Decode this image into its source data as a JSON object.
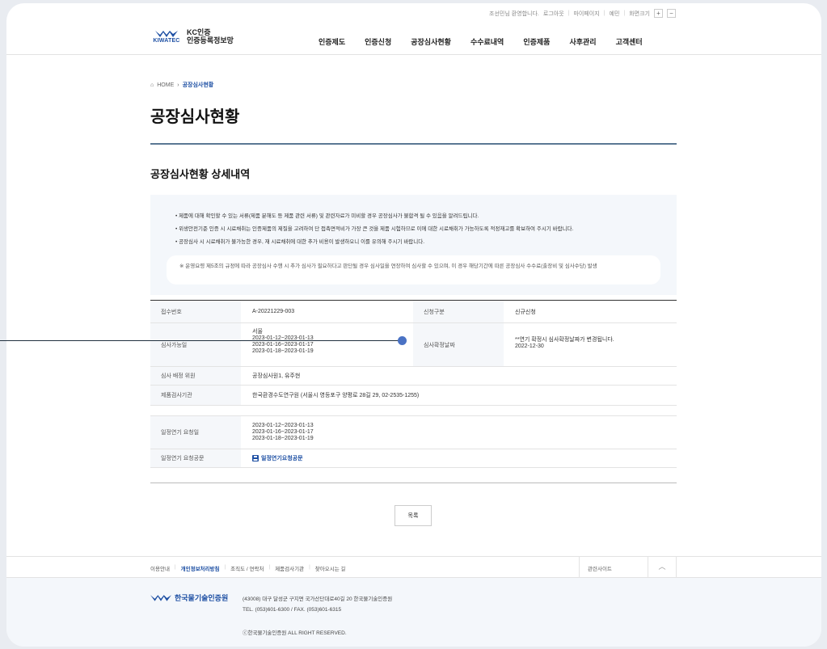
{
  "util": {
    "welcome": "조선민님 환영합니다.",
    "logout": "로그아웃",
    "mypage": "마이페이지",
    "english": "예민",
    "font_size": "화면크기",
    "plus": "+",
    "minus": "−"
  },
  "logo": {
    "brand": "KIWATEC",
    "line1": "KC인증",
    "line2": "인증등록정보망"
  },
  "gnb": [
    "인증제도",
    "인증신청",
    "공장심사현황",
    "수수료내역",
    "인증제품",
    "사후관리",
    "고객센터"
  ],
  "breadcrumb": {
    "home": "HOME",
    "current": "공장심사현황"
  },
  "page_title": "공장심사현황",
  "sub_title": "공장심사현황 상세내역",
  "notice": {
    "items": [
      "• 제품에 대해 확인할 수 있는 서류(제품 분해도 등 제품 관련 서류) 및 관련자료가 미비할 경우 공장심사가 불합격 될 수 있음을 알려드립니다.",
      "• 위생안전기준 인증 시 시료채취는 인증제품의 제질을 고려하여 단 접촉면적비가 가장 큰 것을 제품 시험하므로 이에 대한 시료채취가 가능하도록 적정재고를 확보하여 주시기 바랍니다.",
      "• 공장심사 시 시료채취가 불가능한 경우, 재 시료채취에 대한 추가 비용이 발생하오니 이를 유의해 주시기 바랍니다."
    ],
    "box": "※ 운영요령 제5조의 규정에 따라 공장심사 수행 시 추가 심사가 필요하다고 판단될 경우 심사일을 연장하여 심사할 수 있으며, 이 경우 해당기간에 따른 공장심사 수수료(출장비 및 심사수당) 발생"
  },
  "detail": {
    "receipt_label": "접수번호",
    "receipt_value": "A-20221229-003",
    "apply_type_label": "신청구분",
    "apply_type_value": "신규신청",
    "possible_date_label": "심사가능일",
    "possible_date_lines": [
      "서울",
      "2023-01-12~2023-01-13",
      "2023-01-16~2023-01-17",
      "2023-01-18~2023-01-19"
    ],
    "confirm_date_label": "심사확정날짜",
    "confirm_date_lines": [
      "**연기 확정시 심사확정날짜가 변경됩니다.",
      "2022-12-30"
    ],
    "inspector_label": "심사 배정 위원",
    "inspector_value": "공장심사원1, 유주현",
    "lab_label": "제품검사기관",
    "lab_value": "한국환경수도연구원 (서울시 영등포구 양평로 28길 29, 02-2535-1255)",
    "delay_date_label": "일정연기 요청일",
    "delay_date_lines": [
      "2023-01-12~2023-01-13",
      "2023-01-16~2023-01-17",
      "2023-01-18~2023-01-19"
    ],
    "delay_doc_label": "일정연기 요청공문",
    "delay_doc_link": "일정연기요청공문"
  },
  "list_button": "목록",
  "footer_nav": {
    "items": [
      "이용안내",
      "개인정보처리방침",
      "조직도 / 연락처",
      "제품검사기관",
      "찾아오시는 길"
    ],
    "related": "관련사이트",
    "top": "︿"
  },
  "footer": {
    "org": "한국물기술인증원",
    "address": "(43008) 대구 달성군 구지면 국가산단대로40길 20 한국물기술인증원",
    "tel": "TEL. (053)601-6300 / FAX. (053)601-6315",
    "copyright": "ⓒ한국물기술인증원 ALL RIGHT RESERVED."
  },
  "colors": {
    "accent": "#1d4fa3",
    "title_line": "#5b7894",
    "notice_bg": "#f4f7fb"
  }
}
